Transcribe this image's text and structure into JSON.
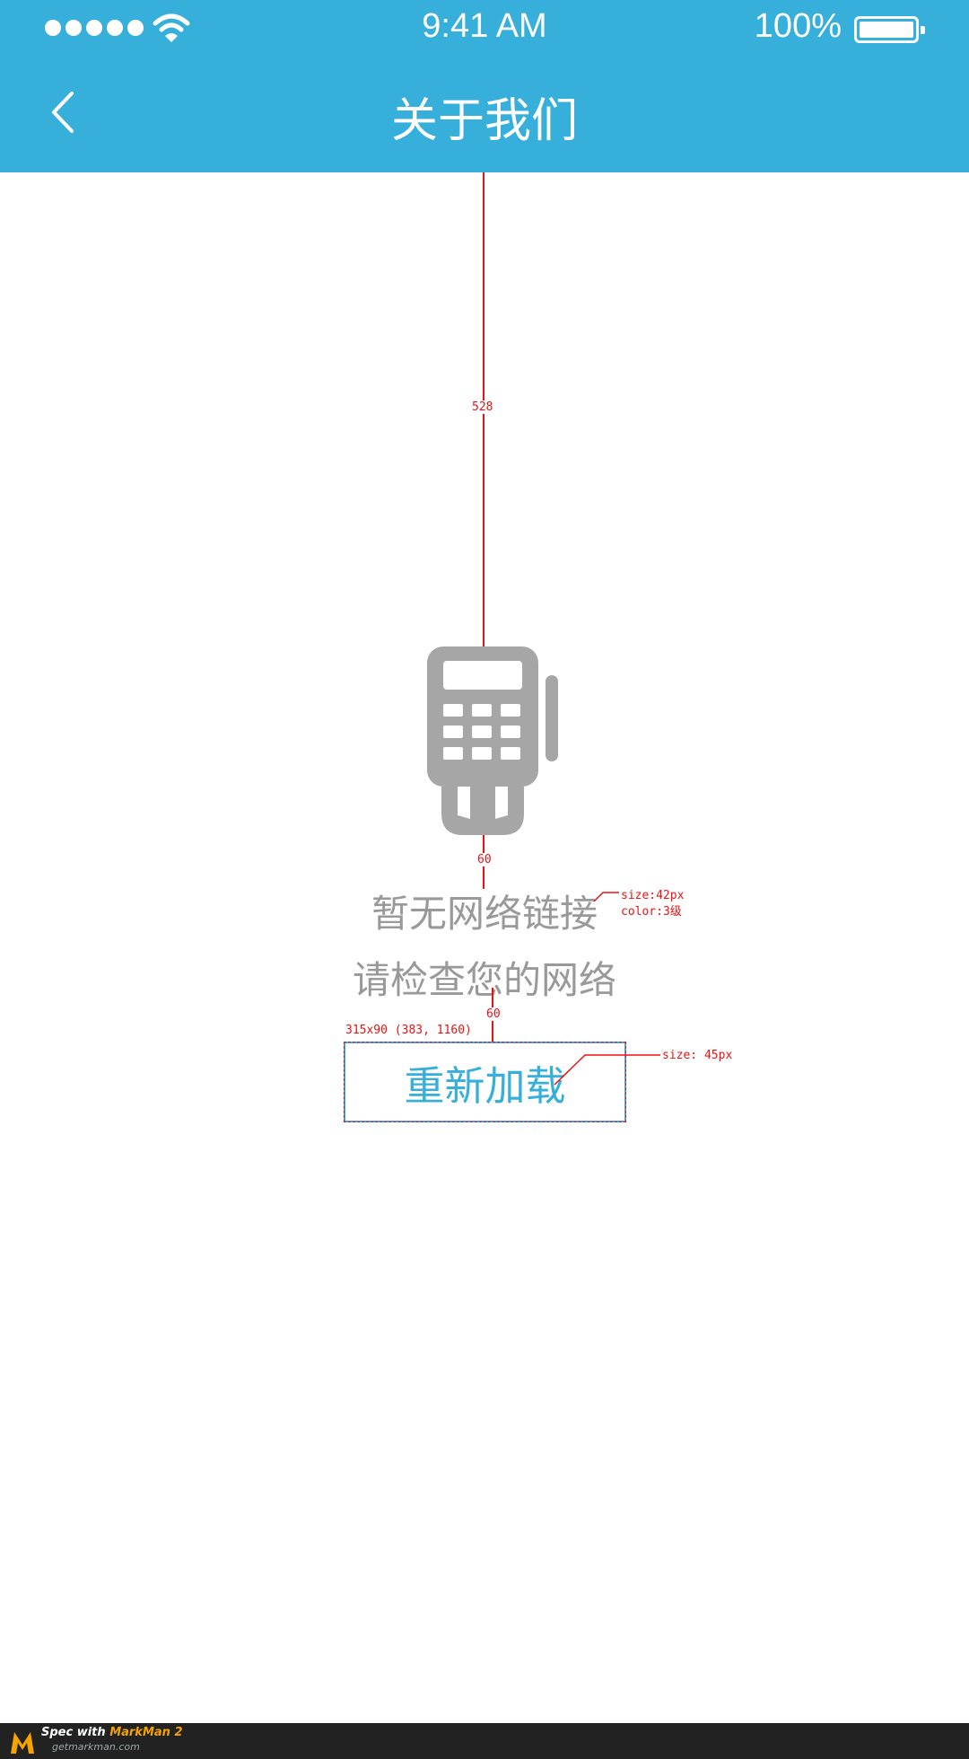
{
  "status_bar": {
    "time": "9:41 AM",
    "battery": "100%"
  },
  "nav": {
    "title": "关于我们",
    "back_icon": "chevron-left-icon"
  },
  "empty_state": {
    "icon": "pos-terminal-icon",
    "title": "暂无网络链接",
    "subtitle": "请检查您的网络",
    "reload_label": "重新加载"
  },
  "spec_annotations": {
    "top_gap": "528",
    "icon_gap": "60",
    "text_note_size": "size:42px",
    "text_note_color": "color:3级",
    "button_gap": "60",
    "button_dims": "315x90 (383, 1160)",
    "button_note_size": "size: 45px"
  },
  "footer": {
    "prefix": "Spec with ",
    "brand": "MarkMan 2",
    "site": "getmarkman.com"
  },
  "colors": {
    "primary": "#37afdb",
    "gray_text": "#999999",
    "icon_gray": "#a6a6a6"
  }
}
